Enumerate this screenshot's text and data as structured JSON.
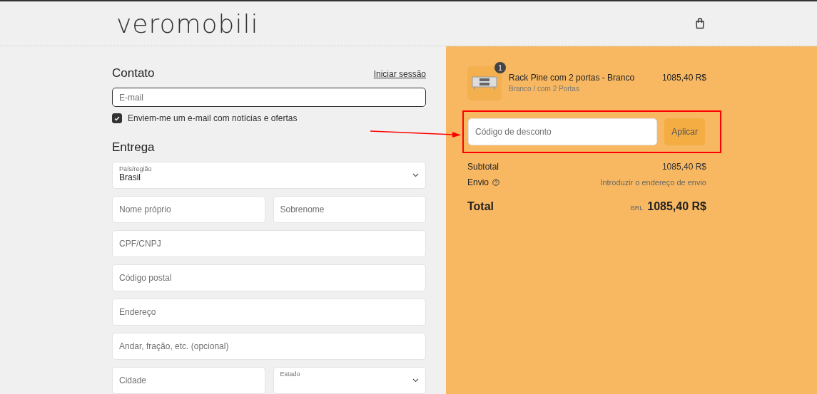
{
  "header": {
    "logo": "veromobili"
  },
  "contact": {
    "title": "Contato",
    "login_link": "Iniciar sessão",
    "email": {
      "placeholder": "E-mail"
    },
    "newsletter": {
      "label": "Enviem-me um e-mail com notícias e ofertas",
      "checked": true
    }
  },
  "delivery": {
    "title": "Entrega",
    "rows": [
      {
        "fields": [
          {
            "kind": "select",
            "label": "País/região",
            "value": "Brasil"
          }
        ]
      },
      {
        "fields": [
          {
            "kind": "text",
            "placeholder": "Nome próprio"
          },
          {
            "kind": "text",
            "placeholder": "Sobrenome"
          }
        ]
      },
      {
        "fields": [
          {
            "kind": "text",
            "placeholder": "CPF/CNPJ"
          }
        ]
      },
      {
        "fields": [
          {
            "kind": "text",
            "placeholder": "Código postal"
          }
        ]
      },
      {
        "fields": [
          {
            "kind": "text",
            "placeholder": "Endereço"
          }
        ]
      },
      {
        "fields": [
          {
            "kind": "text",
            "placeholder": "Andar, fração, etc. (opcional)"
          }
        ]
      },
      {
        "fields": [
          {
            "kind": "text",
            "placeholder": "Cidade"
          },
          {
            "kind": "select",
            "label": "Estado"
          }
        ]
      }
    ]
  },
  "summary": {
    "item": {
      "quantity": "1",
      "name": "Rack Pine com 2 portas - Branco",
      "variant": "Branco / com 2 Portas",
      "price": "1085,40 R$"
    },
    "discount": {
      "placeholder": "Código de desconto",
      "button": "Aplicar"
    },
    "subtotal": {
      "label": "Subtotal",
      "value": "1085,40 R$"
    },
    "shipping": {
      "label": "Envio",
      "value": "Introduzir o endereço de envio"
    },
    "total": {
      "label": "Total",
      "currency": "BRL",
      "value": "1085,40 R$"
    }
  }
}
